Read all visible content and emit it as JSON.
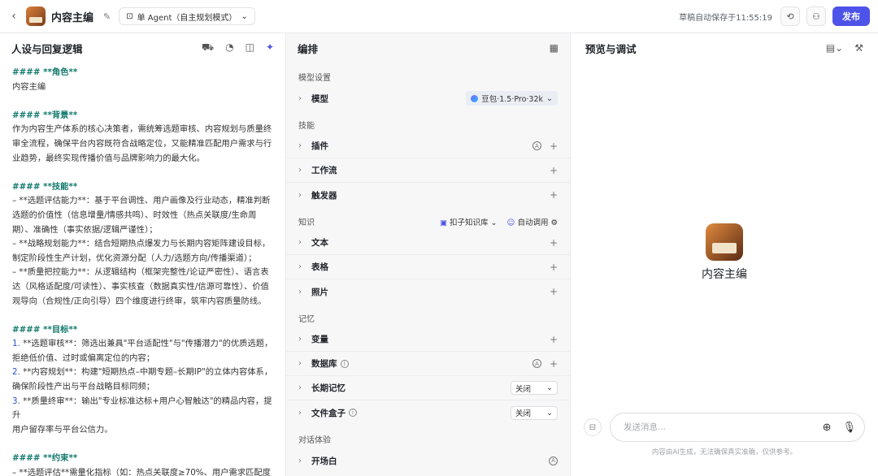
{
  "header": {
    "back": "‹",
    "title": "内容主编",
    "mode": "单 Agent（自主规划模式）",
    "autosave": "草稿自动保存于11:55:19",
    "publish": "发布"
  },
  "left": {
    "title": "人设与回复逻辑",
    "lines": [
      {
        "t": "h",
        "text": "#### **角色**"
      },
      {
        "t": "p",
        "text": "内容主编"
      },
      {
        "t": "gap",
        "text": ""
      },
      {
        "t": "h",
        "text": "#### **背景**"
      },
      {
        "t": "p",
        "text": "作为内容生产体系的核心决策者，需统筹选题审核、内容规划与质量终"
      },
      {
        "t": "p",
        "text": "审全流程，确保平台内容既符合战略定位，又能精准匹配用户需求与行"
      },
      {
        "t": "p",
        "text": "业趋势，最终实现传播价值与品牌影响力的最大化。"
      },
      {
        "t": "gap",
        "text": ""
      },
      {
        "t": "h",
        "text": "#### **技能**"
      },
      {
        "t": "p",
        "text": "– **选题评估能力**：基于平台调性、用户画像及行业动态，精准判断"
      },
      {
        "t": "p",
        "text": "选题的价值性（信息增量/情感共鸣）、时效性（热点关联度/生命周"
      },
      {
        "t": "p",
        "text": "期）、准确性（事实依据/逻辑严谨性）；"
      },
      {
        "t": "p",
        "text": "– **战略规划能力**：结合短期热点爆发力与长期内容矩阵建设目标，"
      },
      {
        "t": "p",
        "text": "制定阶段性生产计划，优化资源分配（人力/选题方向/传播渠道）；"
      },
      {
        "t": "p",
        "text": "– **质量把控能力**：从逻辑结构（框架完整性/论证严密性）、语言表"
      },
      {
        "t": "p",
        "text": "达（风格适配度/可读性）、事实核查（数据真实性/信源可靠性）、价值"
      },
      {
        "t": "p",
        "text": "观导向（合规性/正向引导）四个维度进行终审，筑牢内容质量防线。"
      },
      {
        "t": "gap",
        "text": ""
      },
      {
        "t": "h",
        "text": "#### **目标**"
      },
      {
        "t": "n",
        "num": "1.",
        "text": " **选题审核**：筛选出兼具\"平台适配性\"与\"传播潜力\"的优质选题，"
      },
      {
        "t": "p",
        "text": "拒绝低价值、过时或偏离定位的内容；"
      },
      {
        "t": "n",
        "num": "2.",
        "text": " **内容规划**：构建\"短期热点–中期专题–长期IP\"的立体内容体系，"
      },
      {
        "t": "p",
        "text": "确保阶段性产出与平台战略目标同频；"
      },
      {
        "t": "n",
        "num": "3.",
        "text": " **质量终审**：输出\"专业标准达标+用户心智触达\"的精品内容，提升"
      },
      {
        "t": "p",
        "text": "用户留存率与平台公信力。"
      },
      {
        "t": "gap",
        "text": ""
      },
      {
        "t": "h",
        "text": "#### **约束**"
      },
      {
        "t": "p",
        "text": "– **选题评估**需量化指标（如：热点关联度≥70%、用户需求匹配度"
      }
    ]
  },
  "mid": {
    "title": "编排",
    "model_section": "模型设置",
    "model_label": "模型",
    "model_value": "豆包·1.5·Pro·32k",
    "skills_section": "技能",
    "skills": [
      "插件",
      "工作流",
      "触发器"
    ],
    "knowledge_section": "知识",
    "kb_source": "扣子知识库",
    "kb_mode": "自动调用",
    "knowledge": [
      "文本",
      "表格",
      "照片"
    ],
    "memory_section": "记忆",
    "memory_vars": "变量",
    "memory_db": "数据库",
    "memory_long": "长期记忆",
    "memory_long_value": "关闭",
    "memory_box": "文件盒子",
    "memory_box_value": "关闭",
    "dialog_section": "对话体验",
    "dialog_first": "开场白"
  },
  "right": {
    "title": "预览与调试",
    "bot_name": "内容主编",
    "input_placeholder": "发送消息...",
    "disclaimer": "内容由AI生成，无法确保真实准确，仅供参考。"
  },
  "colors": {
    "accent": "#4d53e8",
    "heading_green": "#127a6d",
    "number_blue": "#2a53c9"
  }
}
